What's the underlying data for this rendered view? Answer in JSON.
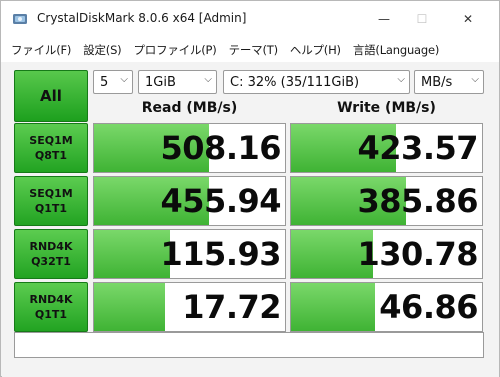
{
  "window": {
    "title": "CrystalDiskMark 8.0.6 x64 [Admin]",
    "minimize": "—",
    "maximize": "☐",
    "close": "✕"
  },
  "menu": {
    "items": [
      "ファイル(F)",
      "設定(S)",
      "プロファイル(P)",
      "テーマ(T)",
      "ヘルプ(H)",
      "言語(Language)"
    ]
  },
  "controls": {
    "all_label": "All",
    "count": "5",
    "size": "1GiB",
    "drive": "C: 32% (35/111GiB)",
    "unit": "MB/s"
  },
  "headers": {
    "read": "Read (MB/s)",
    "write": "Write (MB/s)"
  },
  "tests": [
    {
      "line1": "SEQ1M",
      "line2": "Q8T1",
      "read": "508.16",
      "write": "423.57",
      "read_fill": 0.6,
      "write_fill": 0.55
    },
    {
      "line1": "SEQ1M",
      "line2": "Q1T1",
      "read": "455.94",
      "write": "385.86",
      "read_fill": 0.6,
      "write_fill": 0.6
    },
    {
      "line1": "RND4K",
      "line2": "Q32T1",
      "read": "115.93",
      "write": "130.78",
      "read_fill": 0.4,
      "write_fill": 0.43
    },
    {
      "line1": "RND4K",
      "line2": "Q1T1",
      "read": "17.72",
      "write": "46.86",
      "read_fill": 0.37,
      "write_fill": 0.44
    }
  ],
  "colors": {
    "bar_green": "#3fb334",
    "button_green": "#22a322"
  }
}
